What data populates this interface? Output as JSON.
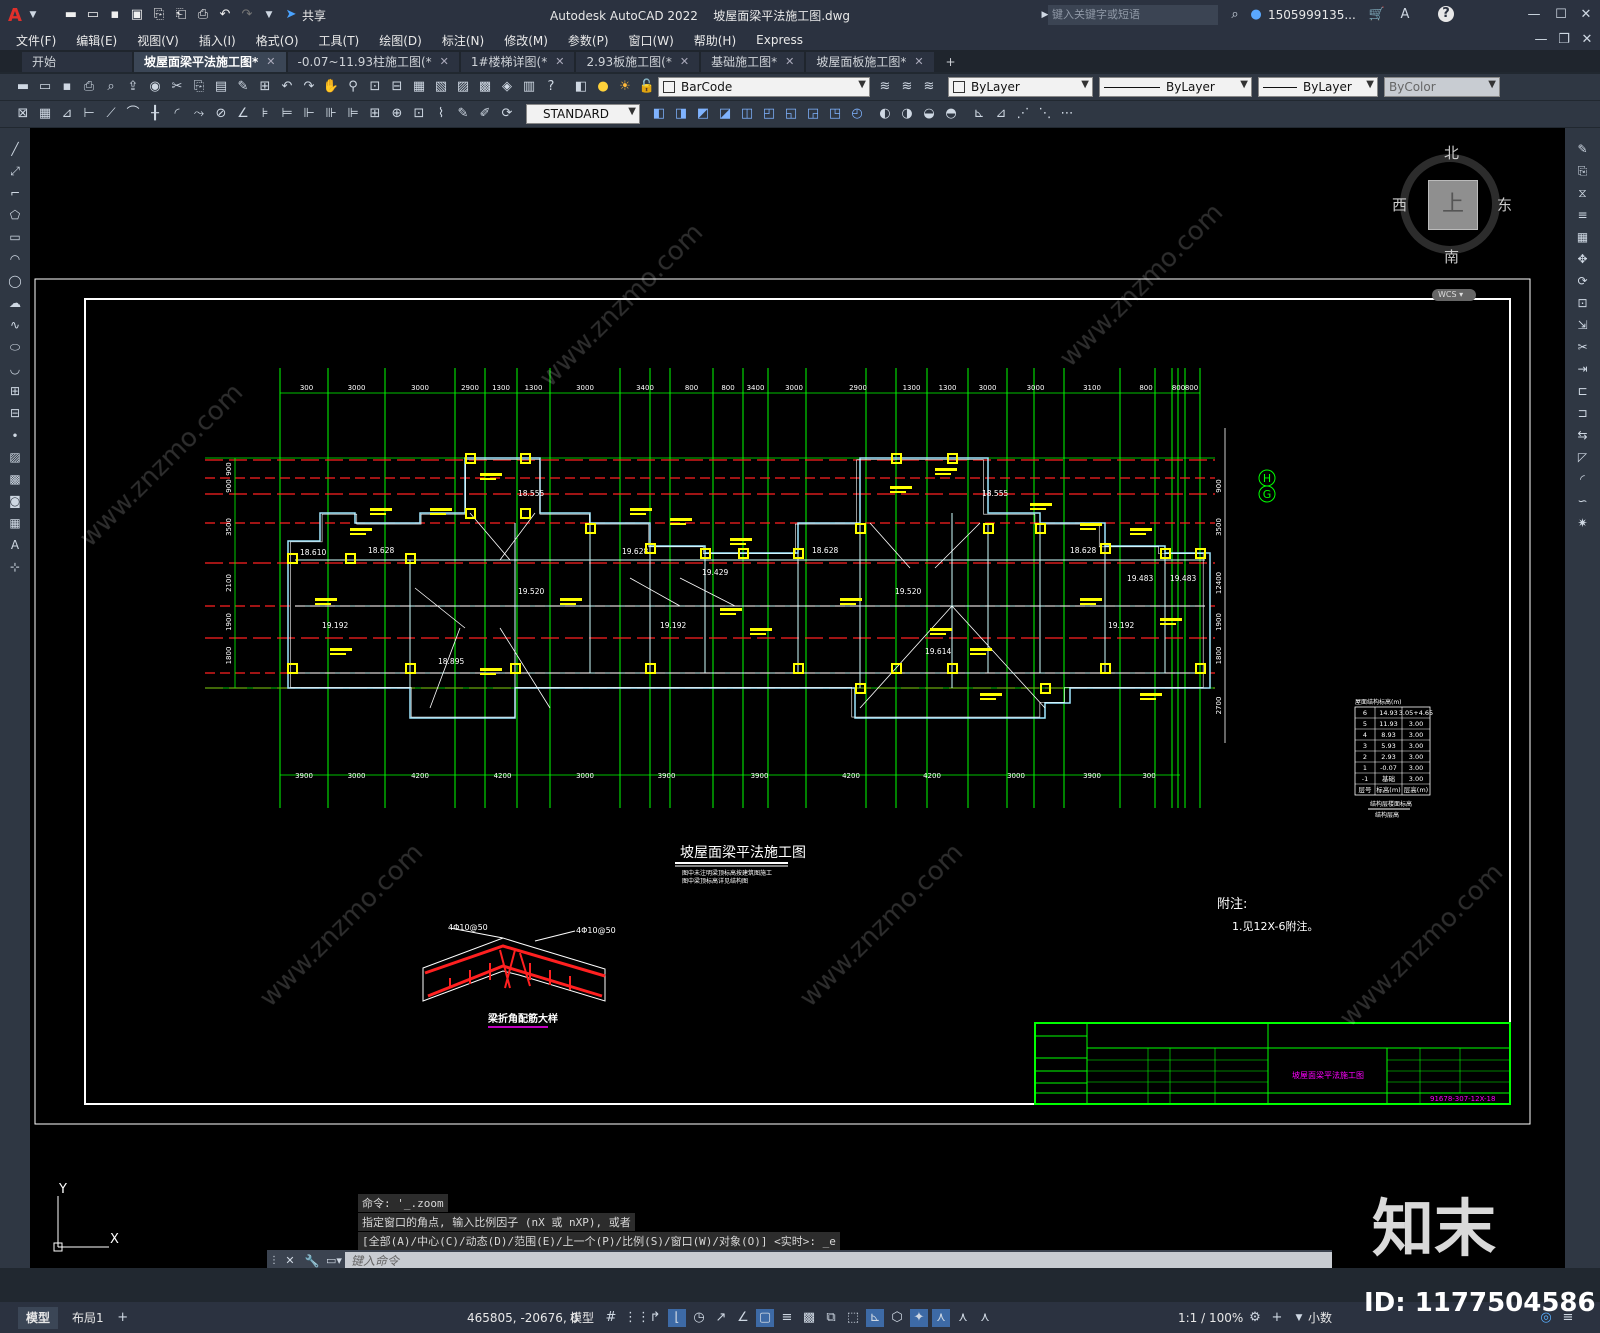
{
  "app": {
    "logo": "A",
    "title": "Autodesk AutoCAD 2022",
    "file": "坡屋面梁平法施工图.dwg",
    "share": "共享",
    "search_placeholder": "键入关键字或短语",
    "user": "1505999135...",
    "help": "?"
  },
  "menu": [
    "文件(F)",
    "编辑(E)",
    "视图(V)",
    "插入(I)",
    "格式(O)",
    "工具(T)",
    "绘图(D)",
    "标注(N)",
    "修改(M)",
    "参数(P)",
    "窗口(W)",
    "帮助(H)",
    "Express"
  ],
  "tabs": [
    {
      "label": "开始",
      "close": ""
    },
    {
      "label": "坡屋面梁平法施工图*",
      "close": "✕"
    },
    {
      "label": "-0.07~11.93柱施工图(*",
      "close": "✕"
    },
    {
      "label": "1#楼梯详图(*",
      "close": "✕"
    },
    {
      "label": "2.93板施工图(*",
      "close": "✕"
    },
    {
      "label": "基础施工图*",
      "close": "✕"
    },
    {
      "label": "坡屋面板施工图*",
      "close": "✕"
    }
  ],
  "new_tab": "+",
  "toolbar": {
    "layer": "BarCode",
    "color": "ByLayer",
    "linetype": "ByLayer",
    "lineweight": "ByLayer",
    "plotstyle": "ByColor",
    "textstyle": "STANDARD"
  },
  "viewcube": {
    "north": "北",
    "south": "南",
    "east": "东",
    "west": "西",
    "top": "上",
    "wcs": "WCS"
  },
  "drawing": {
    "top_dims": [
      "300",
      "3000",
      "3000",
      "2900",
      "1300",
      "1300",
      "3000",
      "3400",
      "800",
      "800",
      "3400",
      "3000",
      "2900",
      "1300",
      "1300",
      "3000",
      "3000",
      "3100",
      "800",
      "800",
      "800"
    ],
    "bottom_dims": [
      "3900",
      "3000",
      "4200",
      "4200",
      "3000",
      "3900",
      "3900",
      "4200",
      "4200",
      "3000",
      "3900",
      "300"
    ],
    "left_dims": [
      "900",
      "900",
      "3500",
      "2100",
      "1900",
      "1800"
    ],
    "right_dims": [
      "900",
      "3500",
      "12400",
      "1900",
      "1800",
      "2700"
    ],
    "axis_labels": [
      "H",
      "G"
    ],
    "elevations": [
      "18.555",
      "18.628",
      "18.610",
      "19.628",
      "19.520",
      "19.429",
      "18.628",
      "19.192",
      "19.520",
      "19.192",
      "18.895",
      "19.614",
      "18.555",
      "18.628",
      "19.483",
      "19.483",
      "19.192"
    ],
    "title": "坡屋面梁平法施工图",
    "title_note": [
      "图中未注明梁顶标高按建筑图施工",
      "图中梁顶标高详见结构图"
    ],
    "detail_title": "梁折角配筋大样",
    "detail_bar1": "4Φ10@50",
    "detail_bar2": "4Φ10@50",
    "notes_title": "附注:",
    "notes_item": "1.见12X-6附注。",
    "table_header": "屋面结构标高(m)",
    "table_rows": [
      [
        "6",
        "14.93",
        "3.05+4.65"
      ],
      [
        "5",
        "11.93",
        "3.00"
      ],
      [
        "4",
        "8.93",
        "3.00"
      ],
      [
        "3",
        "5.93",
        "3.00"
      ],
      [
        "2",
        "2.93",
        "3.00"
      ],
      [
        "1",
        "-0.07",
        "3.00"
      ],
      [
        "-1",
        "基础",
        "3.00"
      ]
    ],
    "table_foot": [
      "层号",
      "标高(m)",
      "层高(m)"
    ],
    "table_caption": "结构层楼面标高",
    "table_caption2": "结构层高",
    "titleblock_name": "坡屋面梁平法施工图",
    "titleblock_code": "91678-307-12X-18"
  },
  "command": {
    "line1": "命令: '_.zoom",
    "line2": "指定窗口的角点, 输入比例因子 (nX 或 nXP), 或者",
    "line3": "[全部(A)/中心(C)/动态(D)/范围(E)/上一个(P)/比例(S)/窗口(W)/对象(O)] <实时>: _e",
    "placeholder": "键入命令"
  },
  "status": {
    "tab_model": "模型",
    "tab_layout": "布局1",
    "coords": "465805, -20676, 0",
    "mode": "模型",
    "scale": "1:1 / 100%",
    "units": "小数"
  },
  "watermark": {
    "brand": "知末",
    "id": "ID: 1177504586",
    "site": "www.znzmo.com"
  }
}
